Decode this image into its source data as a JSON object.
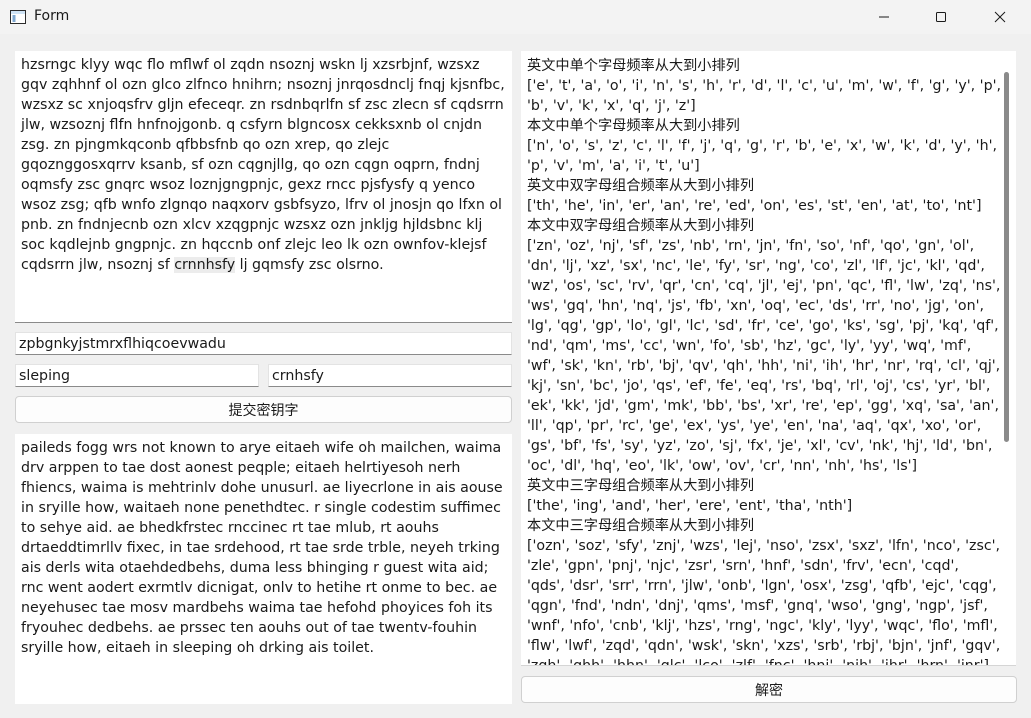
{
  "window": {
    "title": "Form"
  },
  "cipher_text_parts": {
    "before": "hzsrngc klyy wqc flo mflwf ol zqdn nsoznj wskn lj xzsrbjnf, wzsxz gqv zqhhnf ol ozn glco zlfnco hnihrn; nsoznj jnrqosdnclj fnqj kjsnfbc, wzsxz sc xnjoqsfrv gljn efeceqr. zn rsdnbqrlfn sf zsc zlecn sf cqdsrrn jlw, wzsoznj flfn hnfnojgonb. q csfyrn blgncosx cekksxnb ol cnjdn zsg. zn pjngmkqconb qfbbsfnb qo ozn xrep, qo zlejc gqoznggosxqrrv ksanb, sf ozn cqgnjllg, qo ozn cqgn oqprn, fndnj oqmsfy zsc gnqrc wsoz loznjgngpnjc, gexz rncc pjsfysfy q yenco wsoz zsg; qfb wnfo zlgnqo naqxorv gsbfsyzo, lfrv ol jnosjn qo lfxn ol pnb. zn fndnjecnb ozn xlcv xzqgpnjc wzsxz ozn jnkljg hjldsbnc klj soc kqdlejnb gngpnjc. zn hqccnb onf zlejc leo lk ozn ownfov-klejsf cqdsrrn jlw, nsoznj sf ",
    "highlight": "crnnhsfy",
    "after": " lj gqmsfy zsc olsrno."
  },
  "key_input": {
    "value": "zpbgnkyjstmrxflhiqcoevwadu"
  },
  "word_inputs": {
    "left": "sleping",
    "right": "crnhsfy"
  },
  "submit_button": {
    "label": "提交密钥字"
  },
  "decrypted_text": "paileds fogg wrs not known to arye eitaeh wife oh mailchen, waima drv arppen to tae dost aonest peqple; eitaeh helrtiyesoh nerh fhiencs, waima is mehtrinlv dohe unusurl. ae liyecrlone in ais aouse in sryille how, waitaeh none penethdtec. r single codestim suffimec to sehye aid. ae bhedkfrstec rnccinec rt tae mlub, rt aouhs drtaeddtimrllv fixec, in tae srdehood, rt tae srde trble, neyeh trking ais derls wita otaehdedbehs, duma less bhinging r guest wita aid; rnc went aodert exrmtlv dicnigat, onlv to hetihe rt onme to bec. ae neyehusec tae mosv mardbehs waima tae hefohd phoyices foh its fryouhec dedbehs. ae prssec ten aouhs out of tae twentv-fouhin sryille how, eitaeh in sleeping oh drking ais toilet.",
  "stats": {
    "lines": [
      "英文中单个字母频率从大到小排列",
      "['e', 't', 'a', 'o', 'i', 'n', 's', 'h', 'r', 'd', 'l', 'c', 'u', 'm', 'w', 'f', 'g', 'y', 'p', 'b', 'v', 'k', 'x', 'q', 'j', 'z']",
      "本文中单个字母频率从大到小排列",
      "['n', 'o', 's', 'z', 'c', 'l', 'f', 'j', 'q', 'g', 'r', 'b', 'e', 'x', 'w', 'k', 'd', 'y', 'h', 'p', 'v', 'm', 'a', 'i', 't', 'u']",
      "英文中双字母组合频率从大到小排列",
      "['th', 'he', 'in', 'er', 'an', 're', 'ed', 'on', 'es', 'st', 'en', 'at', 'to', 'nt']",
      "本文中双字母组合频率从大到小排列",
      "['zn', 'oz', 'nj', 'sf', 'zs', 'nb', 'rn', 'jn', 'fn', 'so', 'nf', 'qo', 'gn', 'ol', 'dn', 'lj', 'xz', 'sx', 'nc', 'le', 'fy', 'sr', 'ng', 'co', 'zl', 'lf', 'jc', 'kl', 'qd', 'wz', 'os', 'sc', 'rv', 'qr', 'cn', 'cq', 'jl', 'ej', 'pn', 'qc', 'fl', 'lw', 'zq', 'ns', 'ws', 'gq', 'hn', 'nq', 'js', 'fb', 'xn', 'oq', 'ec', 'ds', 'rr', 'no', 'jg', 'on', 'lg', 'qg', 'gp', 'lo', 'gl', 'lc', 'sd', 'fr', 'ce', 'go', 'ks', 'sg', 'pj', 'kq', 'qf', 'nd', 'qm', 'ms', 'cc', 'wn', 'fo', 'sb', 'hz', 'gc', 'ly', 'yy', 'wq', 'mf', 'wf', 'sk', 'kn', 'rb', 'bj', 'qv', 'qh', 'hh', 'ni', 'ih', 'hr', 'nr', 'rq', 'cl', 'qj', 'kj', 'sn', 'bc', 'jo', 'qs', 'ef', 'fe', 'eq', 'rs', 'bq', 'rl', 'oj', 'cs', 'yr', 'bl', 'ek', 'kk', 'jd', 'gm', 'mk', 'bb', 'bs', 'xr', 're', 'ep', 'gg', 'xq', 'sa', 'an', 'll', 'qp', 'pr', 'rc', 'ge', 'ex', 'ys', 'ye', 'en', 'na', 'aq', 'qx', 'xo', 'or', 'gs', 'bf', 'fs', 'sy', 'yz', 'zo', 'sj', 'fx', 'je', 'xl', 'cv', 'nk', 'hj', 'ld', 'bn', 'oc', 'dl', 'hq', 'eo', 'lk', 'ow', 'ov', 'cr', 'nn', 'nh', 'hs', 'ls']",
      "英文中三字母组合频率从大到小排列",
      "['the', 'ing', 'and', 'her', 'ere', 'ent', 'tha', 'nth']",
      "本文中三字母组合频率从大到小排列",
      "['ozn', 'soz', 'sfy', 'znj', 'wzs', 'lej', 'nso', 'zsx', 'sxz', 'lfn', 'nco', 'zsc', 'zle', 'gpn', 'pnj', 'njc', 'zsr', 'srn', 'hnf', 'sdn', 'frv', 'ecn', 'cqd', 'qds', 'dsr', 'srr', 'rrn', 'jlw', 'onb', 'lgn', 'osx', 'zsg', 'qfb', 'ejc', 'cqg', 'qgn', 'fnd', 'ndn', 'dnj', 'qms', 'msf', 'gnq', 'wso', 'gng', 'ngp', 'jsf', 'wnf', 'nfo', 'cnb', 'klj', 'hzs', 'rng', 'ngc', 'kly', 'lyy', 'wqc', 'flo', 'mfl', 'flw', 'lwf', 'zqd', 'qdn', 'wsk', 'skn', 'xzs', 'srb', 'rbj', 'bjn', 'jnf', 'gqv', 'zqh', 'qhh', 'hhn', 'glc', 'lco', 'zlf', 'fnc', 'hni', 'nih', 'ihr', 'hrn', 'jnr']"
    ]
  },
  "decrypt_button": {
    "label": "解密"
  }
}
